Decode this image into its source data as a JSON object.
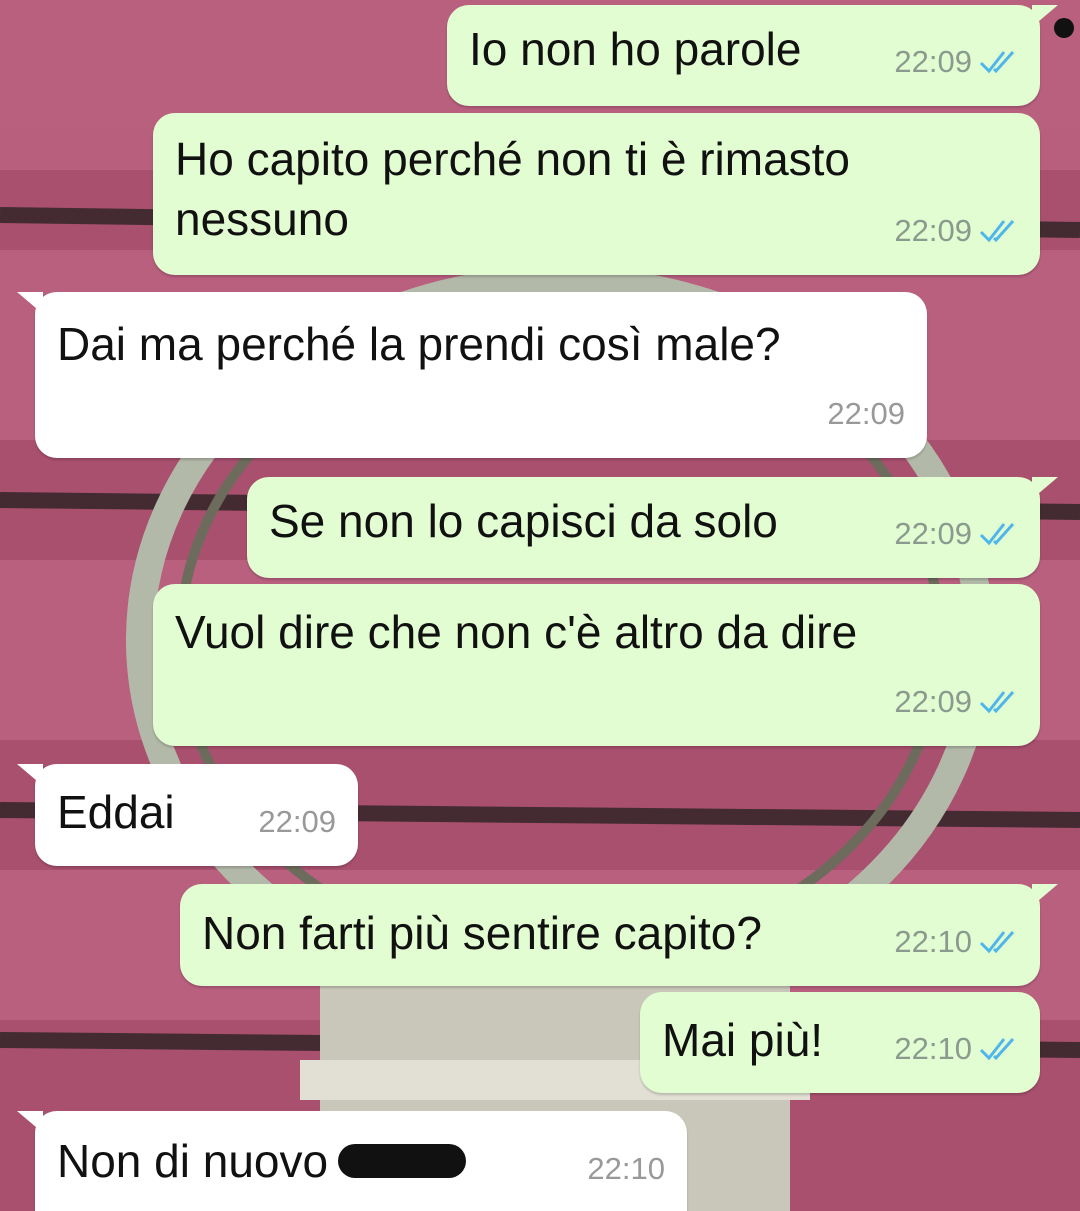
{
  "messages": [
    {
      "text": "Io non ho parole",
      "time": "22:09",
      "dir": "out"
    },
    {
      "text_line1": "Ho capito perché non ti è rimasto",
      "text_line2": "nessuno",
      "time": "22:09",
      "dir": "out"
    },
    {
      "text": "Dai ma perché la prendi così male?",
      "time": "22:09",
      "dir": "in"
    },
    {
      "text": "Se non lo capisci da solo",
      "time": "22:09",
      "dir": "out"
    },
    {
      "text": "Vuol dire che non c'è altro da dire",
      "time": "22:09",
      "dir": "out"
    },
    {
      "text": "Eddai",
      "time": "22:09",
      "dir": "in"
    },
    {
      "text": "Non farti più sentire capito?",
      "time": "22:10",
      "dir": "out"
    },
    {
      "text": "Mai più!",
      "time": "22:10",
      "dir": "out"
    },
    {
      "text": "Non di nuovo",
      "time": "22:10",
      "dir": "in"
    }
  ],
  "colors": {
    "outgoing": "#e2fdd1",
    "incoming": "#ffffff",
    "read_ticks": "#4fb6ec",
    "wallpaper": "#a8506f"
  },
  "icons": {
    "read_receipt": "double-check-icon",
    "redaction": "redaction-scribble"
  }
}
